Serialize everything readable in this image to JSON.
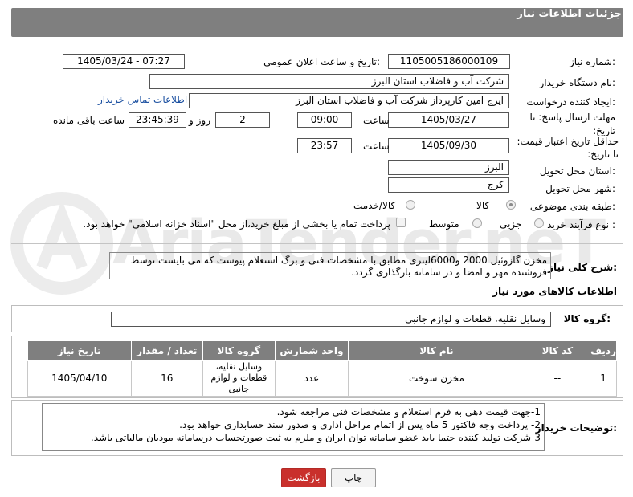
{
  "header": {
    "title": "جزئیات اطلاعات نیاز"
  },
  "watermark": {
    "text": "AriaTender.neT",
    "color": "#e4e4e4"
  },
  "form": {
    "need_number": {
      "label": "شماره نیاز:",
      "value": "1105005186000109"
    },
    "announce_datetime": {
      "label": "تاریخ و ساعت اعلان عمومی:",
      "value": "1405/03/24 - 07:27"
    },
    "buyer_org": {
      "label": "نام دستگاه خریدار:",
      "value": "شرکت آب و فاضلاب استان البرز"
    },
    "requester": {
      "label": "ایجاد کننده درخواست:",
      "value": "ایرج امین کارپرداز شرکت آب و فاضلاب استان البرز",
      "contact_link": "اطلاعات تماس خریدار"
    },
    "reply_deadline": {
      "label": "مهلت ارسال پاسخ: تا تاریخ:",
      "date": "1405/03/27",
      "time_label": "ساعت",
      "time": "09:00",
      "days": "2",
      "days_label": "روز و",
      "remaining": "23:45:39",
      "remaining_label": "ساعت باقی مانده"
    },
    "price_validity": {
      "label": "حداقل تاریخ اعتبار قیمت: تا تاریخ:",
      "date": "1405/09/30",
      "time_label": "ساعت",
      "time": "23:57"
    },
    "province": {
      "label": "استان محل تحویل:",
      "value": "البرز"
    },
    "city": {
      "label": "شهر محل تحویل:",
      "value": "کرج"
    },
    "category": {
      "label": "طبقه بندی موضوعی:",
      "options": [
        "کالا",
        "کالا/خدمت"
      ],
      "selected": "کالا"
    },
    "purchase_type": {
      "label": "نوع فرآیند خرید :",
      "options": [
        "جزیی",
        "متوسط"
      ],
      "selected": "",
      "payment_note": "پرداخت تمام یا بخشی از مبلغ خرید،از محل \"اسناد خزانه اسلامی\" خواهد بود."
    }
  },
  "description": {
    "label": "شرح کلی نیاز:",
    "text": "مخزن گازوئیل 2000 و6000لیتری مطابق با مشخصات فنی و برگ استعلام پیوست که می بایست توسط فروشنده مهر و امضا و در سامانه بارگذاری گردد."
  },
  "goods_section": {
    "title": "اطلاعات کالاهای مورد نیاز",
    "group_label": "گروه کالا:",
    "group_value": "وسایل نقلیه، قطعات و لوازم جانبی"
  },
  "goods_table": {
    "columns": [
      "ردیف",
      "کد کالا",
      "نام کالا",
      "واحد شمارش",
      "گروه کالا",
      "تعداد / مقدار",
      "تاریخ نیاز"
    ],
    "rows": [
      {
        "row": "1",
        "code": "--",
        "name": "مخزن سوخت",
        "unit": "عدد",
        "group": "وسایل نقلیه، قطعات و لوازم جانبی",
        "qty": "16",
        "date": "1405/04/10"
      }
    ]
  },
  "buyer_notes": {
    "label": "توضیحات خریدار:",
    "lines": [
      "1-جهت قیمت دهی به فرم استعلام و مشخصات فنی مراجعه شود.",
      "2- پرداخت وجه فاکتور 5 ماه پس از اتمام مراحل اداری و صدور سند حسابداری خواهد بود.",
      "3-شرکت تولید کننده حتما باید عضو سامانه توان ایران و ملزم به ثبت صورتحساب درسامانه مودیان مالیاتی باشد."
    ]
  },
  "buttons": {
    "print": "چاپ",
    "back": "بازگشت"
  }
}
